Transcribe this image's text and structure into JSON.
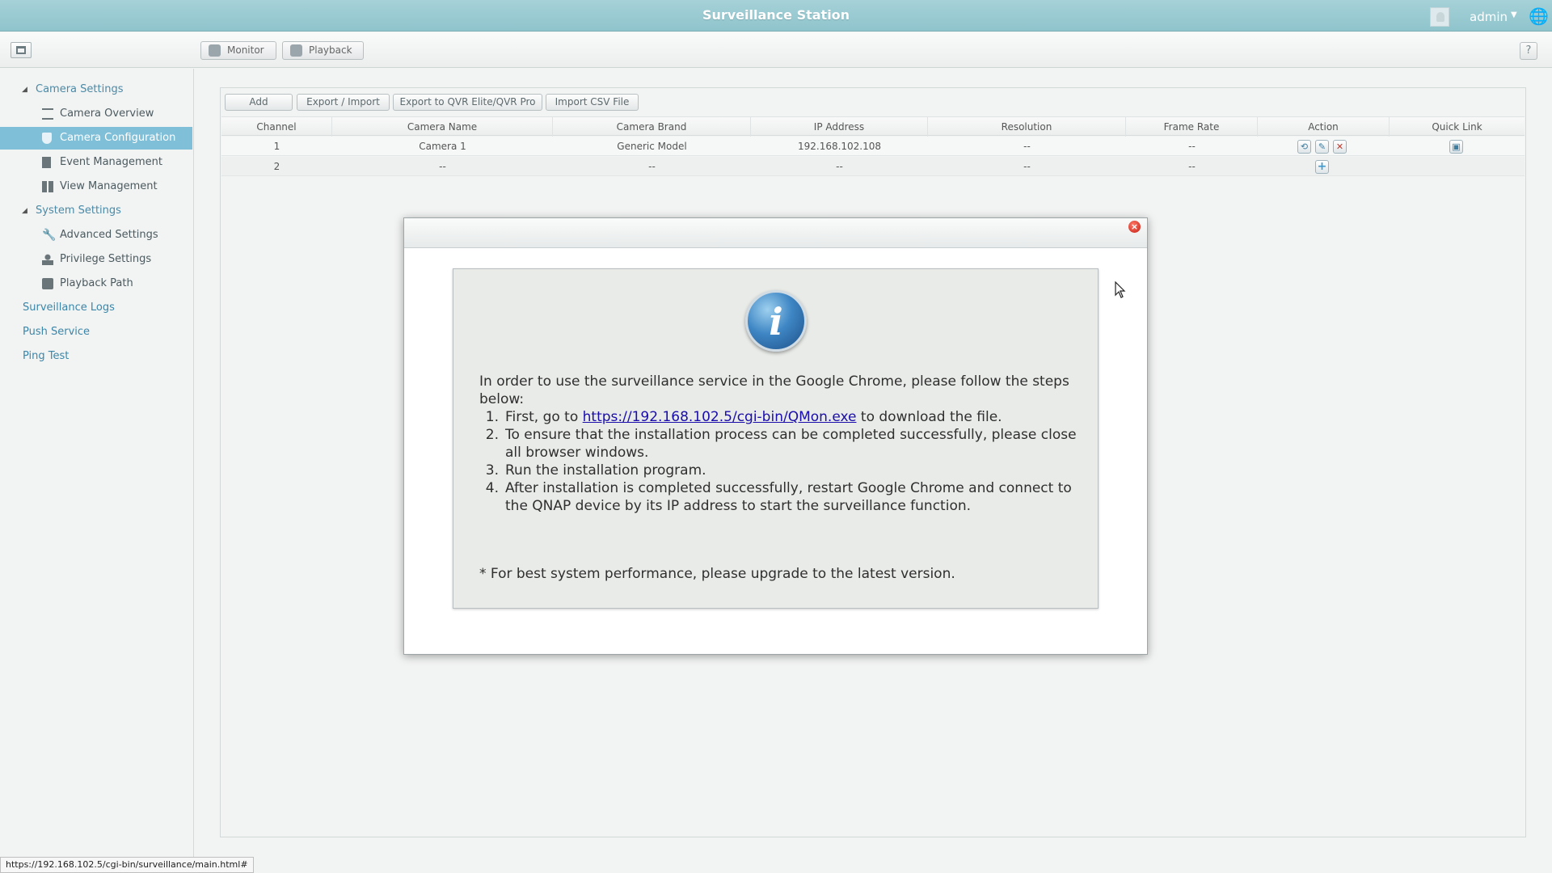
{
  "app": {
    "title": "Surveillance Station",
    "user": "admin"
  },
  "toolbar": {
    "monitor_label": "Monitor",
    "playback_label": "Playback",
    "help_label": "?"
  },
  "sidebar": {
    "items": [
      {
        "label": "Camera Settings",
        "kind": "group"
      },
      {
        "label": "Camera Overview",
        "kind": "item"
      },
      {
        "label": "Camera Configuration",
        "kind": "item-active"
      },
      {
        "label": "Event Management",
        "kind": "item"
      },
      {
        "label": "View Management",
        "kind": "item"
      },
      {
        "label": "System Settings",
        "kind": "group"
      },
      {
        "label": "Advanced Settings",
        "kind": "item"
      },
      {
        "label": "Privilege Settings",
        "kind": "item"
      },
      {
        "label": "Playback Path",
        "kind": "item"
      },
      {
        "label": "Surveillance Logs",
        "kind": "link"
      },
      {
        "label": "Push Service",
        "kind": "link"
      },
      {
        "label": "Ping Test",
        "kind": "link"
      }
    ]
  },
  "actions": {
    "add": "Add",
    "export_import": "Export / Import",
    "export_qvr": "Export to QVR Elite/QVR Pro",
    "import_csv": "Import CSV File"
  },
  "table": {
    "columns": [
      "Channel",
      "Camera Name",
      "Camera Brand",
      "IP Address",
      "Resolution",
      "Frame Rate",
      "Action",
      "Quick Link"
    ],
    "rows": [
      [
        "1",
        "Camera 1",
        "Generic Model",
        "192.168.102.108",
        "--",
        "--"
      ],
      [
        "2",
        "--",
        "--",
        "--",
        "--",
        "--"
      ]
    ]
  },
  "dialog": {
    "intro": "In order to use the surveillance service in the Google Chrome, please follow the steps below:",
    "step1_prefix": "First, go to",
    "step1_link": "https://192.168.102.5/cgi-bin/QMon.exe",
    "step1_suffix": "to download the file.",
    "step2": "To ensure that the installation process can be completed successfully, please close all browser windows.",
    "step3": "Run the installation program.",
    "step4": "After installation is completed successfully, restart Google Chrome and connect to the QNAP device by its IP address to start the surveillance function.",
    "note": "* For best system performance, please upgrade to the latest version.",
    "numbers": [
      "1.",
      "2.",
      "3.",
      "4."
    ]
  },
  "status_bar": {
    "url": "https://192.168.102.5/cgi-bin/surveillance/main.html#"
  },
  "colors": {
    "titlebar": "#8fc4cc",
    "active_item": "#7fbfd8",
    "link": "#1a0dab"
  }
}
